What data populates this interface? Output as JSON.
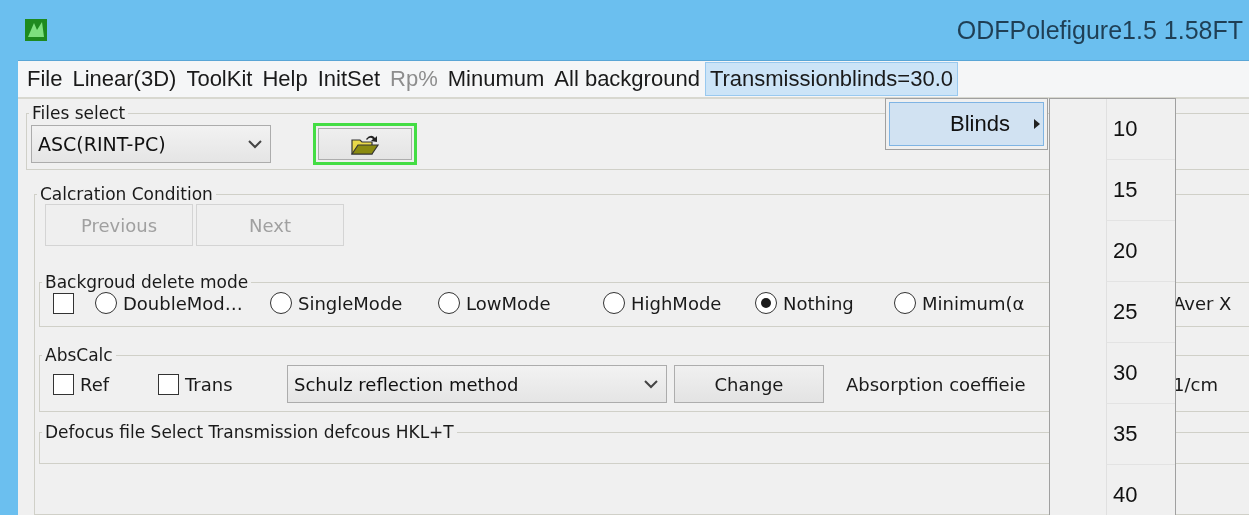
{
  "window": {
    "title": "ODFPolefigure1.5 1.58FT"
  },
  "menu": [
    {
      "label": "File",
      "disabled": false,
      "selected": false
    },
    {
      "label": "Linear(3D)",
      "disabled": false,
      "selected": false
    },
    {
      "label": "ToolKit",
      "disabled": false,
      "selected": false
    },
    {
      "label": "Help",
      "disabled": false,
      "selected": false
    },
    {
      "label": "InitSet",
      "disabled": false,
      "selected": false
    },
    {
      "label": "Rp%",
      "disabled": true,
      "selected": false
    },
    {
      "label": "Minumum",
      "disabled": false,
      "selected": false
    },
    {
      "label": "All background",
      "disabled": false,
      "selected": false
    },
    {
      "label": "Transmissionblinds=30.0",
      "disabled": false,
      "selected": true
    }
  ],
  "menu_popup": [
    {
      "label": "Blinds",
      "selected": true
    }
  ],
  "submenu": [
    "10",
    "15",
    "20",
    "25",
    "30",
    "35",
    "40"
  ],
  "files_select": {
    "legend": "Files select",
    "format": "ASC(RINT-PC)",
    "open_focused": true
  },
  "calculation": {
    "legend": "Calcration Condition",
    "buttons": [
      {
        "label": "Previous",
        "disabled": true
      },
      {
        "label": "Next",
        "disabled": true
      }
    ]
  },
  "background": {
    "legend": "Backgroud delete mode",
    "checked": false,
    "modes": [
      {
        "label": "DoubleMod…",
        "selected": false
      },
      {
        "label": "SingleMode",
        "selected": false
      },
      {
        "label": "LowMode",
        "selected": false
      },
      {
        "label": "HighMode",
        "selected": false
      },
      {
        "label": "Nothing",
        "selected": true
      },
      {
        "label": "Minimum(α",
        "selected": false
      }
    ],
    "aside": "Aver X"
  },
  "abs_calc": {
    "legend": "AbsCalc",
    "checks": [
      {
        "label": "Ref",
        "checked": false
      },
      {
        "label": "Trans",
        "checked": false
      }
    ],
    "method": "Schulz reflection method",
    "button": "Change",
    "coefficient_label": "Absorption coeffieie",
    "unit": "1/cm"
  },
  "defocus": {
    "legend": "Defocus file Select Transmission defcous HKL+T"
  }
}
